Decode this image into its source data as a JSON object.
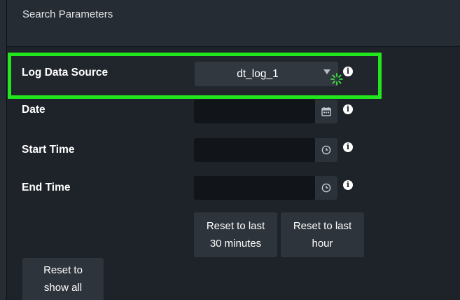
{
  "panel": {
    "title": "Search Parameters"
  },
  "form": {
    "log_data_source": {
      "label": "Log Data Source",
      "value": "dt_log_1"
    },
    "date": {
      "label": "Date",
      "value": ""
    },
    "start_time": {
      "label": "Start Time",
      "value": ""
    },
    "end_time": {
      "label": "End Time",
      "value": ""
    }
  },
  "buttons": {
    "reset_30_line1": "Reset to last",
    "reset_30_line2": "30 minutes",
    "reset_hour_line1": "Reset to last",
    "reset_hour_line2": "hour",
    "reset_all_line1": "Reset to",
    "reset_all_line2": "show all"
  },
  "icons": {
    "info": "i",
    "info_icon": "info-icon",
    "calendar_icon": "calendar-icon",
    "clock_icon": "clock-icon",
    "dropdown_icon": "chevron-down-icon",
    "cursor_icon": "busy-cursor-icon"
  },
  "colors": {
    "highlight": "#22e61e",
    "background": "#1e2329",
    "header": "#262c33",
    "input": "#111419",
    "button": "#2e343b"
  }
}
